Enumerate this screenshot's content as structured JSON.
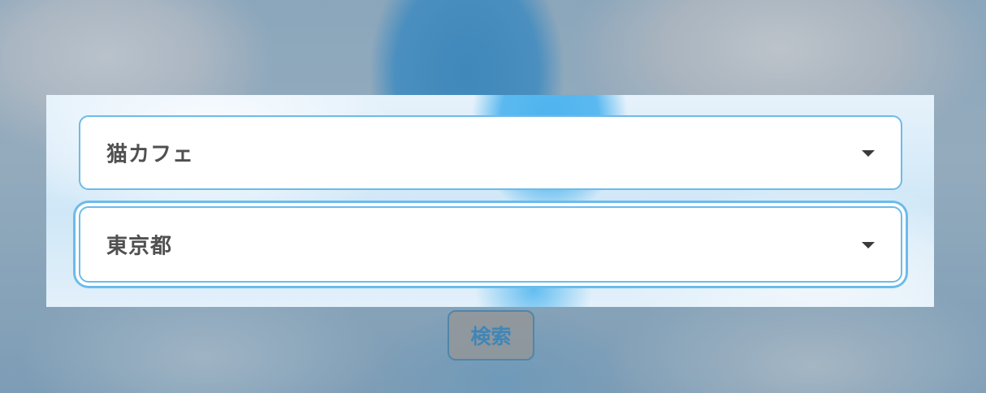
{
  "form": {
    "category_select": {
      "value": "猫カフェ"
    },
    "location_select": {
      "value": "東京都"
    },
    "search_button_label": "検索"
  },
  "icons": {
    "dropdown": "chevron-down-icon"
  },
  "colors": {
    "select_border": "#6cbbe9",
    "button_text": "#3f86b8",
    "button_border": "#4f86a9",
    "label_text": "#505050"
  }
}
